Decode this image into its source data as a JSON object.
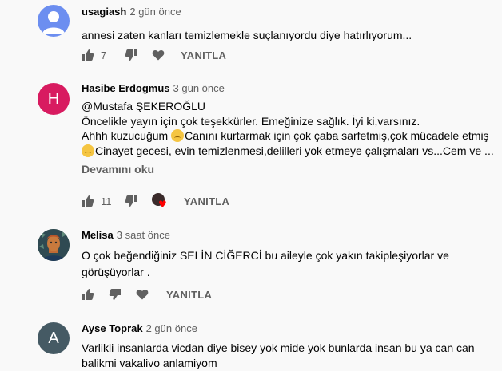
{
  "comments": [
    {
      "author": "usagiash",
      "time": "2 gün önce",
      "avatar_color": "#6c8ef0",
      "lines": [
        "annesi zaten kanları temizlemekle suçlanıyordu diye hatırlıyorum..."
      ],
      "likes": "7",
      "reply_label": "YANITLA"
    },
    {
      "author": "Hasibe Erdogmus",
      "time": "3 gün önce",
      "avatar_letter": "H",
      "avatar_color": "#d81b60",
      "lines": [
        "@Mustafa ŞEKEROĞLU",
        "Öncelikle yayın için çok teşekkürler. Emeğinize sağlık. İyi ki,varsınız.",
        "Ahhh kuzucuğum",
        "Canını kurtarmak için çok çaba sarfetmiş,çok mücadele etmiş",
        "Cinayet gecesi, evin temizlenmesi,delilleri yok etmeye çalışmaları  vs...Cem ve ..."
      ],
      "read_more": "Devamını oku",
      "likes": "11",
      "reply_label": "YANITLA"
    },
    {
      "author": "Melisa",
      "time": "3 saat önce",
      "avatar_color": "#3e5b45",
      "lines": [
        "O çok beğendiğiniz SELİN CİĞERCİ bu aileyle çok yakın takipleşiyorlar ve",
        "görüşüyorlar ."
      ],
      "reply_label": "YANITLA"
    },
    {
      "author": "Ayse Toprak",
      "time": "2 gün önce",
      "avatar_letter": "A",
      "avatar_color": "#455a64",
      "lines": [
        "Varlikli insanlarda vicdan diye bisey yok mide yok bunlarda insan bu ya can can",
        "balikmi vakalivo anlamiyom"
      ]
    }
  ]
}
